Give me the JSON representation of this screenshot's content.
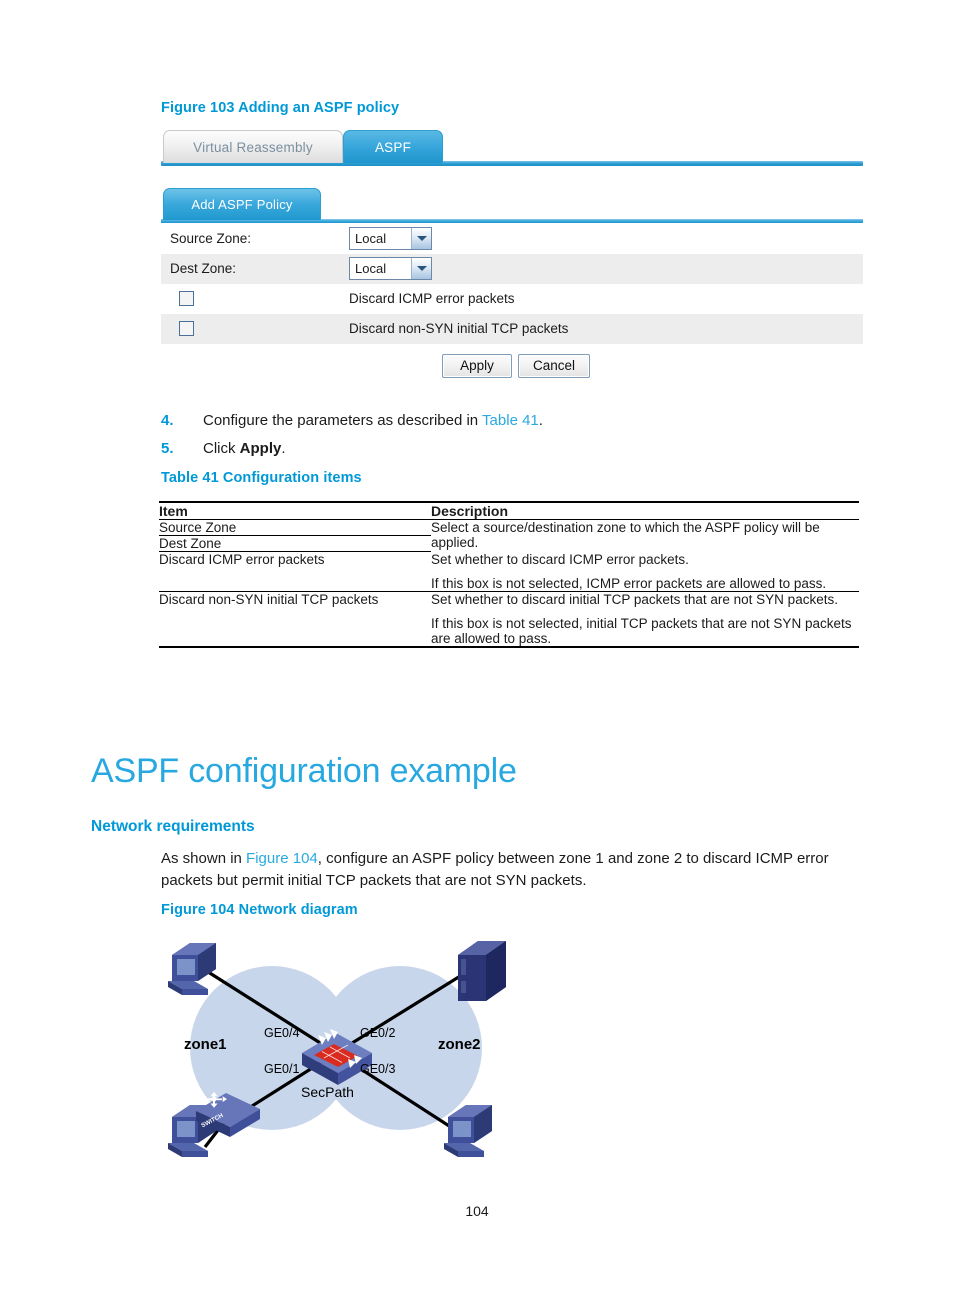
{
  "figure103": {
    "caption": "Figure 103 Adding an ASPF policy",
    "tabs": [
      {
        "label": "Virtual Reassembly",
        "active": false
      },
      {
        "label": "ASPF",
        "active": true
      }
    ],
    "panel": {
      "tab_label": "Add ASPF Policy",
      "fields": [
        {
          "label": "Source Zone:",
          "value": "Local"
        },
        {
          "label": "Dest Zone:",
          "value": "Local"
        }
      ],
      "checkboxes": [
        {
          "label": "Discard ICMP error packets",
          "checked": false
        },
        {
          "label": "Discard non-SYN initial TCP packets",
          "checked": false
        }
      ],
      "buttons": {
        "apply": "Apply",
        "cancel": "Cancel"
      }
    }
  },
  "steps": [
    {
      "number": "4.",
      "text_before": "Configure the parameters as described in ",
      "link": "Table 41",
      "text_after": "."
    },
    {
      "number": "5.",
      "text_before": "Click ",
      "bold": "Apply",
      "text_after": "."
    }
  ],
  "table41": {
    "caption": "Table 41 Configuration items",
    "headers": [
      "Item",
      "Description"
    ],
    "rows": [
      {
        "items": [
          "Source Zone",
          "Dest Zone"
        ],
        "description": [
          "Select a source/destination zone to which the ASPF policy will be applied."
        ]
      },
      {
        "items": [
          "Discard ICMP error packets"
        ],
        "description": [
          "Set whether to discard ICMP error packets.",
          "If this box is not selected, ICMP error packets are allowed to pass."
        ]
      },
      {
        "items": [
          "Discard non-SYN initial TCP packets"
        ],
        "description": [
          "Set whether to discard initial TCP packets that are not SYN packets.",
          "If this box is not selected, initial TCP packets that are not SYN packets are allowed to pass."
        ]
      }
    ]
  },
  "section": {
    "h1": "ASPF configuration example",
    "h2": "Network requirements",
    "paragraph_before": "As shown in ",
    "paragraph_link": "Figure 104",
    "paragraph_after": ", configure an ASPF policy between zone 1 and zone 2 to discard ICMP error packets but permit initial TCP packets that are not SYN packets."
  },
  "figure104": {
    "caption": "Figure 104 Network diagram",
    "zones": [
      "zone1",
      "zone2"
    ],
    "device_label": "SecPath",
    "interfaces": [
      "GE0/4",
      "GE0/2",
      "GE0/1",
      "GE0/3"
    ],
    "switch_label": "SWITCH",
    "colors": {
      "zone_fill": "#c8d6ec",
      "device_blue": "#3b4f96",
      "device_light": "#6d7fc0",
      "accent_red": "#d92b20"
    }
  },
  "page_number": "104",
  "colors": {
    "accent_blue": "#0099d8",
    "link_blue": "#29a9e0",
    "heading_blue": "#28a8e0"
  }
}
